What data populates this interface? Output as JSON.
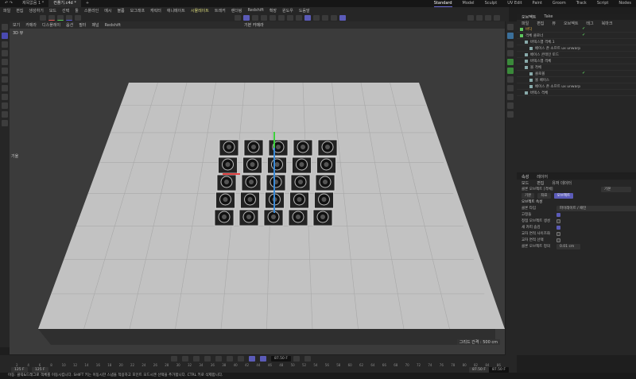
{
  "titlebar": {
    "tabs": [
      "제목없음 1 *",
      "컨플기.c4d *"
    ],
    "add": "+",
    "layouts": [
      "Standard",
      "Model",
      "Sculpt",
      "UV Edit",
      "Paint",
      "Groom",
      "Track",
      "Script",
      "Nodes"
    ]
  },
  "menu": [
    "파일",
    "편집",
    "생성하기",
    "모드",
    "선택",
    "툴",
    "스플라인",
    "메시",
    "볼륨",
    "모그래프",
    "캐릭터",
    "애니메이트",
    "시뮬레이트",
    "트래커",
    "렌더링",
    "Redshift",
    "확장",
    "윈도우",
    "도움말"
  ],
  "viewport": {
    "menu": [
      "보기",
      "카메라",
      "디스플레이",
      "옵션",
      "필터",
      "패널",
      "Redshift"
    ],
    "camera": "기본 카메라",
    "corner": "3D 뷰",
    "grid_label": "그리드 간격 : 500 cm",
    "axis_label": "기울"
  },
  "objects": {
    "tabs": [
      "오브젝트",
      "Take"
    ],
    "menu": [
      "파일",
      "편집",
      "뷰",
      "오브젝트",
      "태그",
      "북마크"
    ],
    "items": [
      {
        "name": "바닥",
        "indent": 0,
        "check": true
      },
      {
        "name": "격체 클로너",
        "indent": 0,
        "check": true
      },
      {
        "name": "버텍스맵 격체.1",
        "indent": 1
      },
      {
        "name": "베이스 존  소프트 ux unwarp",
        "indent": 2
      },
      {
        "name": "베이스 콘테인 토드",
        "indent": 1
      },
      {
        "name": "버텍스맵 격체",
        "indent": 1
      },
      {
        "name": "볼 격체",
        "indent": 1
      },
      {
        "name": "콜로볼",
        "indent": 2,
        "check": true
      },
      {
        "name": "볼 베이스",
        "indent": 2
      },
      {
        "name": "베이스 존  소프트 ux unwarp",
        "indent": 2
      },
      {
        "name": "버텍스 격체",
        "indent": 1
      }
    ]
  },
  "attributes": {
    "tabs": [
      "속성",
      "레이어"
    ],
    "menu": [
      "모드",
      "편집",
      "유저 데이터"
    ],
    "object_name": "클론 오브젝트 [격체]",
    "preset": "기본",
    "subtabs": [
      "기본",
      "좌표",
      "오브젝트"
    ],
    "section": "오브젝트 속성",
    "rows": [
      {
        "label": "클론 타입",
        "value": "파이레이트 / 패턴"
      },
      {
        "label": "고정들",
        "checked": true
      },
      {
        "label": "정점 오브젝트 생성",
        "checked": false
      },
      {
        "label": "새 카피 숨김",
        "checked": true
      },
      {
        "label": "교차 면적 사이즈화",
        "checked": false
      },
      {
        "label": "교차 면적 선택",
        "checked": false
      },
      {
        "label": "클론 오브젝트 정의",
        "value": "0.01 cm"
      }
    ]
  },
  "timeline": {
    "current": "87.50 F",
    "start": "125 F",
    "start2": "125 F",
    "end": "87.50 F",
    "end2": "87.50 F",
    "ticks": [
      2,
      4,
      6,
      8,
      10,
      12,
      14,
      16,
      18,
      20,
      22,
      24,
      26,
      28,
      30,
      32,
      34,
      36,
      38,
      40,
      42,
      44,
      46,
      48,
      50,
      52,
      54,
      56,
      58,
      60,
      62,
      64,
      66,
      68,
      70,
      72,
      74,
      76,
      78,
      80,
      82,
      84,
      86
    ]
  },
  "status": "이동: 클릭&드래그로 객체를 이동시킵니다. SHIFT 키는 이동시한 스냅을 적용하고 포인트 모드시엔 선택을 추가합니다. CTRL 키로 삭제합니다."
}
